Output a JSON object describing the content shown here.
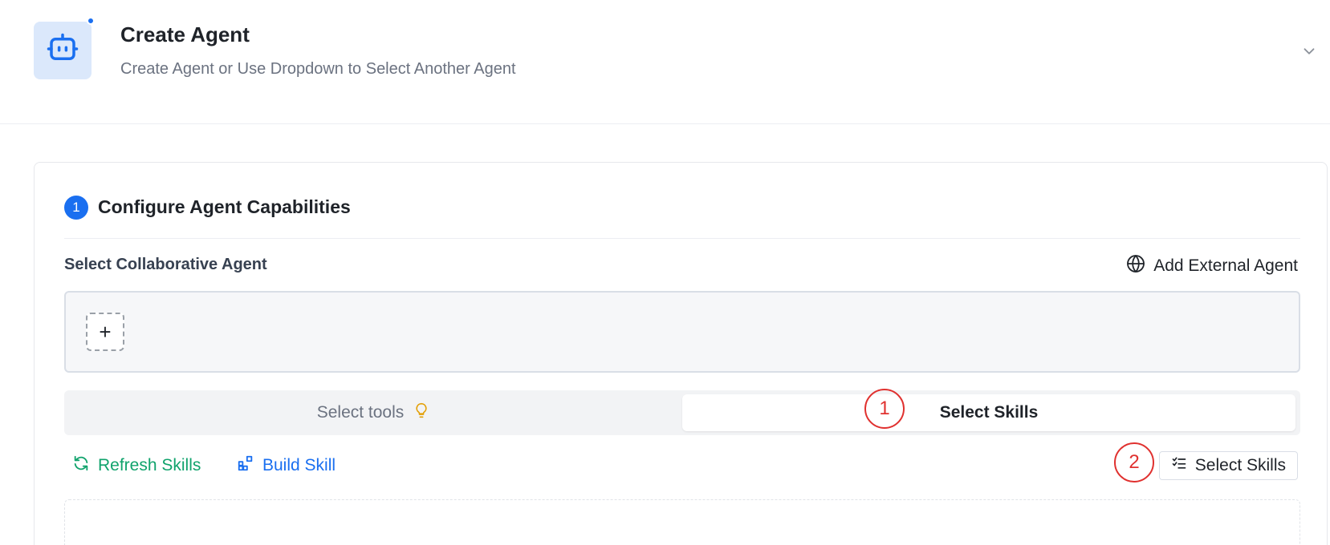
{
  "header": {
    "title": "Create Agent",
    "subtitle": "Create Agent or Use Dropdown to Select Another Agent",
    "avatar_icon": "robot-icon",
    "dropdown_icon": "chevron-down-icon"
  },
  "config": {
    "step_number": "1",
    "title": "Configure Agent Capabilities",
    "collab_label": "Select Collaborative Agent",
    "add_external_label": "Add External Agent",
    "add_slot_symbol": "+"
  },
  "tabs": [
    {
      "label": "Select tools",
      "icon": "lightbulb-icon",
      "active": false
    },
    {
      "label": "Select Skills",
      "active": true
    }
  ],
  "actions": {
    "refresh_label": "Refresh Skills",
    "build_label": "Build Skill",
    "select_skills_label": "Select Skills"
  },
  "annotations": [
    "1",
    "2"
  ],
  "colors": {
    "accent": "#1a6ff0",
    "refresh": "#10a36c",
    "annotation": "#e0312f"
  }
}
